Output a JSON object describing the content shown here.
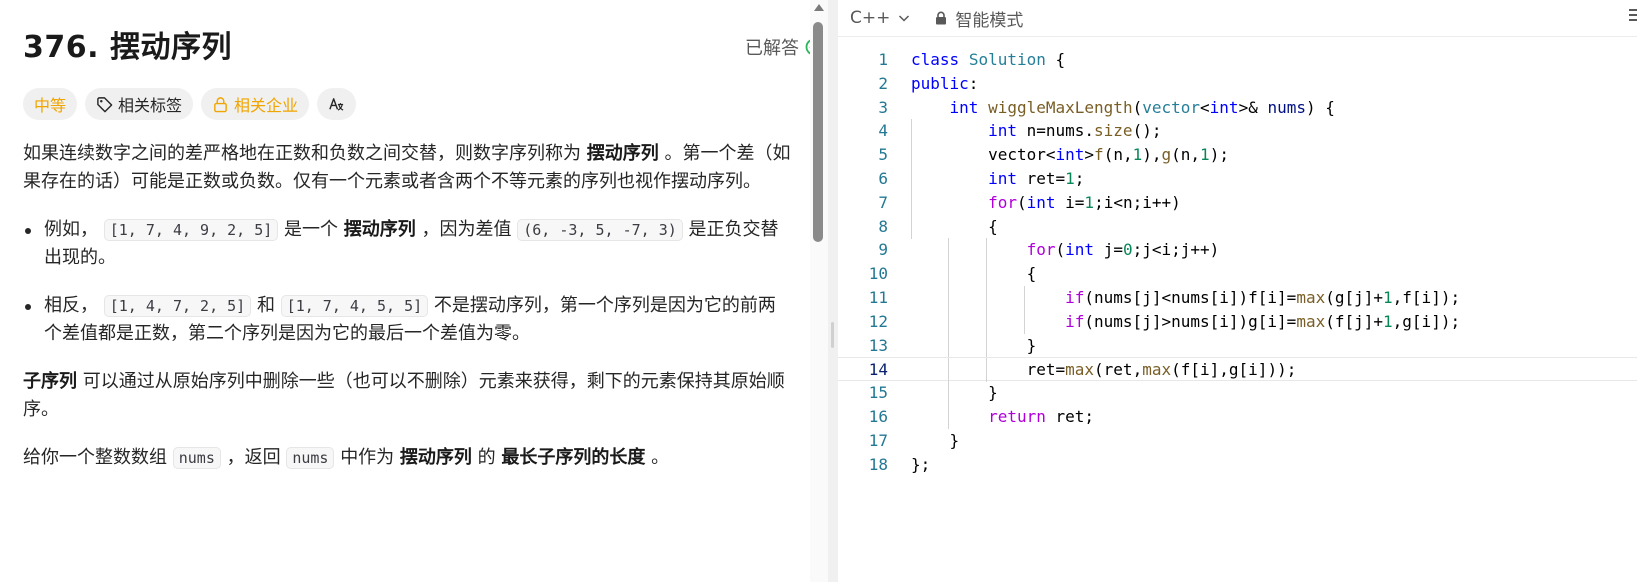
{
  "problem": {
    "title": "376. 摆动序列",
    "solved_label": "已解答",
    "tags": {
      "difficulty": "中等",
      "related_tags": "相关标签",
      "related_companies": "相关企业",
      "translate": "Aあ"
    },
    "desc": {
      "p1_a": "如果连续数字之间的差严格地在正数和负数之间交替，则数字序列称为",
      "p1_b": "摆动序列",
      "p1_c": "。第一个差（如果存在的话）可能是正数或负数。仅有一个元素或者含两个不等元素的序列也视作摆动序列。",
      "li1_a": "例如，",
      "li1_code1": "[1, 7, 4, 9, 2, 5]",
      "li1_b": "是一个",
      "li1_bold": "摆动序列",
      "li1_c": "，因为差值",
      "li1_code2": "(6, -3, 5, -7, 3)",
      "li1_d": "是正负交替出现的。",
      "li2_a": "相反，",
      "li2_code1": "[1, 4, 7, 2, 5]",
      "li2_b": "和",
      "li2_code2": "[1, 7, 4, 5, 5]",
      "li2_c": "不是摆动序列，第一个序列是因为它的前两个差值都是正数，第二个序列是因为它的最后一个差值为零。",
      "p2_bold": "子序列",
      "p2_a": "可以通过从原始序列中删除一些（也可以不删除）元素来获得，剩下的元素保持其原始顺序。",
      "p3_a": "给你一个整数数组",
      "p3_code1": "nums",
      "p3_b": "，返回",
      "p3_code2": "nums",
      "p3_c": "中作为",
      "p3_bold1": "摆动序列",
      "p3_d": "的",
      "p3_bold2": "最长子序列的长度",
      "p3_e": "。"
    }
  },
  "editor": {
    "language": "C++",
    "mode": "智能模式",
    "active_line": 14,
    "lines": [
      {
        "n": "1"
      },
      {
        "n": "2"
      },
      {
        "n": "3"
      },
      {
        "n": "4"
      },
      {
        "n": "5"
      },
      {
        "n": "6"
      },
      {
        "n": "7"
      },
      {
        "n": "8"
      },
      {
        "n": "9"
      },
      {
        "n": "10"
      },
      {
        "n": "11"
      },
      {
        "n": "12"
      },
      {
        "n": "13"
      },
      {
        "n": "14"
      },
      {
        "n": "15"
      },
      {
        "n": "16"
      },
      {
        "n": "17"
      },
      {
        "n": "18"
      }
    ]
  },
  "colors": {
    "accent_green": "#2db55d",
    "difficulty_color": "#f0a500",
    "line_number": "#237893"
  }
}
